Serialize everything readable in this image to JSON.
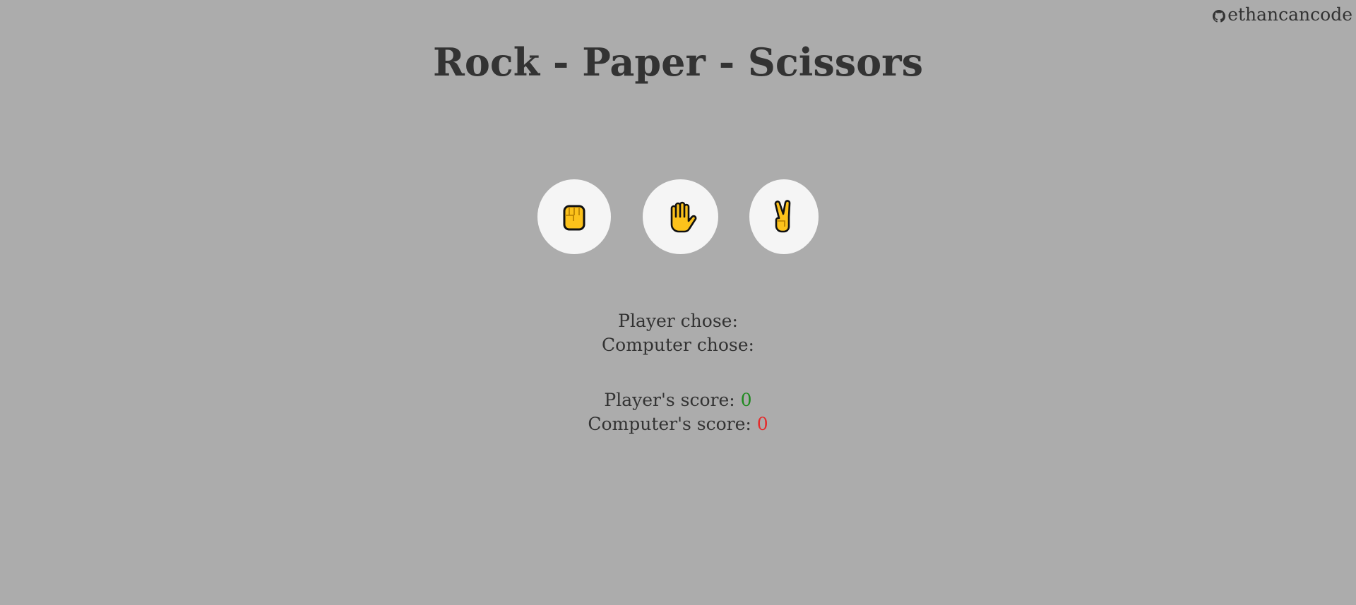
{
  "header": {
    "github_user": "ethancancode",
    "title": "Rock - Paper - Scissors"
  },
  "choices": [
    {
      "name": "rock",
      "icon": "raised-fist-icon"
    },
    {
      "name": "paper",
      "icon": "raised-hand-icon"
    },
    {
      "name": "scissors",
      "icon": "victory-hand-icon"
    }
  ],
  "results": {
    "player_chose_label": "Player chose:",
    "player_choice": "",
    "computer_chose_label": "Computer chose:",
    "computer_choice": ""
  },
  "scores": {
    "player_label": "Player's score:",
    "player_value": "0",
    "computer_label": "Computer's score:",
    "computer_value": "0"
  },
  "colors": {
    "background": "#acacac",
    "button_bg": "#f5f5f5",
    "hand_fill": "#fcc21b",
    "player_score": "#1e8a1e",
    "computer_score": "#e52b2b"
  }
}
